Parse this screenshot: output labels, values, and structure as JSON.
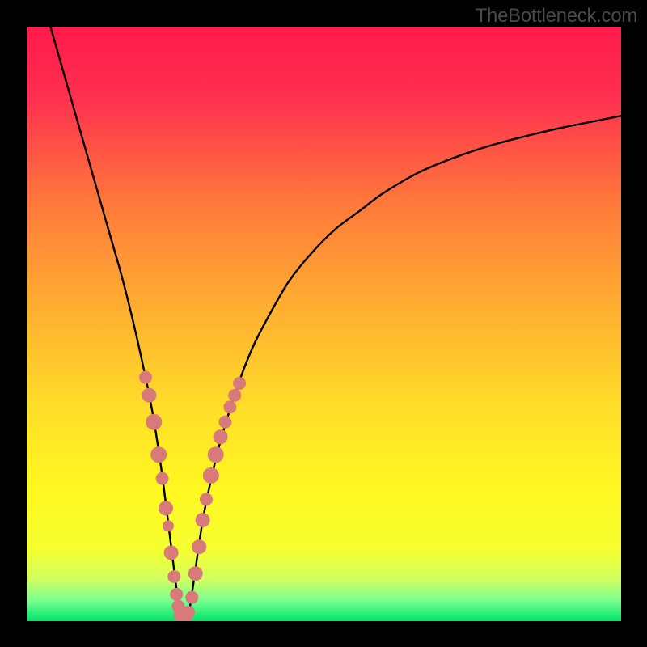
{
  "watermark": "TheBottleneck.com",
  "chart_data": {
    "type": "line",
    "title": "",
    "xlabel": "",
    "ylabel": "",
    "xlim": [
      0,
      100
    ],
    "ylim": [
      0,
      100
    ],
    "gradient_stops": [
      {
        "offset": 0.0,
        "color": "#ff1a4a"
      },
      {
        "offset": 0.12,
        "color": "#ff3050"
      },
      {
        "offset": 0.3,
        "color": "#ff7a3a"
      },
      {
        "offset": 0.48,
        "color": "#ffb030"
      },
      {
        "offset": 0.65,
        "color": "#ffe028"
      },
      {
        "offset": 0.78,
        "color": "#fff820"
      },
      {
        "offset": 0.88,
        "color": "#f6ff30"
      },
      {
        "offset": 0.93,
        "color": "#d0ff60"
      },
      {
        "offset": 0.965,
        "color": "#7aff90"
      },
      {
        "offset": 1.0,
        "color": "#00e56a"
      }
    ],
    "series": [
      {
        "name": "curve",
        "x": [
          4,
          6,
          8,
          10,
          12,
          14,
          16,
          18,
          20,
          21,
          22,
          23,
          24,
          25,
          26,
          27,
          28,
          29,
          30,
          32,
          34,
          36,
          38,
          40,
          44,
          48,
          52,
          56,
          60,
          66,
          72,
          78,
          84,
          90,
          96,
          100
        ],
        "y": [
          100,
          93,
          86,
          79,
          72,
          65,
          58,
          50,
          41,
          36,
          30,
          23,
          15,
          7,
          0,
          0,
          6,
          13,
          19,
          28,
          35,
          41,
          46,
          50,
          57,
          62,
          66,
          69,
          72,
          75.5,
          78,
          80,
          81.6,
          83,
          84.2,
          85
        ]
      }
    ],
    "markers": {
      "name": "highlighted-points",
      "color": "#d87a7a",
      "points": [
        {
          "x": 20.0,
          "y": 41.0,
          "r": 8
        },
        {
          "x": 20.6,
          "y": 38.0,
          "r": 9
        },
        {
          "x": 21.4,
          "y": 33.5,
          "r": 10
        },
        {
          "x": 22.2,
          "y": 28.0,
          "r": 10
        },
        {
          "x": 22.8,
          "y": 24.0,
          "r": 8
        },
        {
          "x": 23.4,
          "y": 19.0,
          "r": 9
        },
        {
          "x": 23.8,
          "y": 16.0,
          "r": 7
        },
        {
          "x": 24.3,
          "y": 11.5,
          "r": 9
        },
        {
          "x": 24.8,
          "y": 7.5,
          "r": 8
        },
        {
          "x": 25.2,
          "y": 4.5,
          "r": 8
        },
        {
          "x": 25.5,
          "y": 2.5,
          "r": 8
        },
        {
          "x": 25.8,
          "y": 1.0,
          "r": 8
        },
        {
          "x": 26.2,
          "y": 0.5,
          "r": 8
        },
        {
          "x": 26.7,
          "y": 0.5,
          "r": 8
        },
        {
          "x": 27.2,
          "y": 1.5,
          "r": 8
        },
        {
          "x": 27.8,
          "y": 4.0,
          "r": 8
        },
        {
          "x": 28.4,
          "y": 8.0,
          "r": 9
        },
        {
          "x": 29.0,
          "y": 12.5,
          "r": 9
        },
        {
          "x": 29.6,
          "y": 17.0,
          "r": 9
        },
        {
          "x": 30.2,
          "y": 20.5,
          "r": 8
        },
        {
          "x": 31.0,
          "y": 24.5,
          "r": 10
        },
        {
          "x": 31.8,
          "y": 28.0,
          "r": 10
        },
        {
          "x": 32.6,
          "y": 31.0,
          "r": 9
        },
        {
          "x": 33.4,
          "y": 33.5,
          "r": 8
        },
        {
          "x": 34.2,
          "y": 36.0,
          "r": 8
        },
        {
          "x": 35.0,
          "y": 38.0,
          "r": 8
        },
        {
          "x": 35.8,
          "y": 40.0,
          "r": 8
        }
      ]
    }
  }
}
